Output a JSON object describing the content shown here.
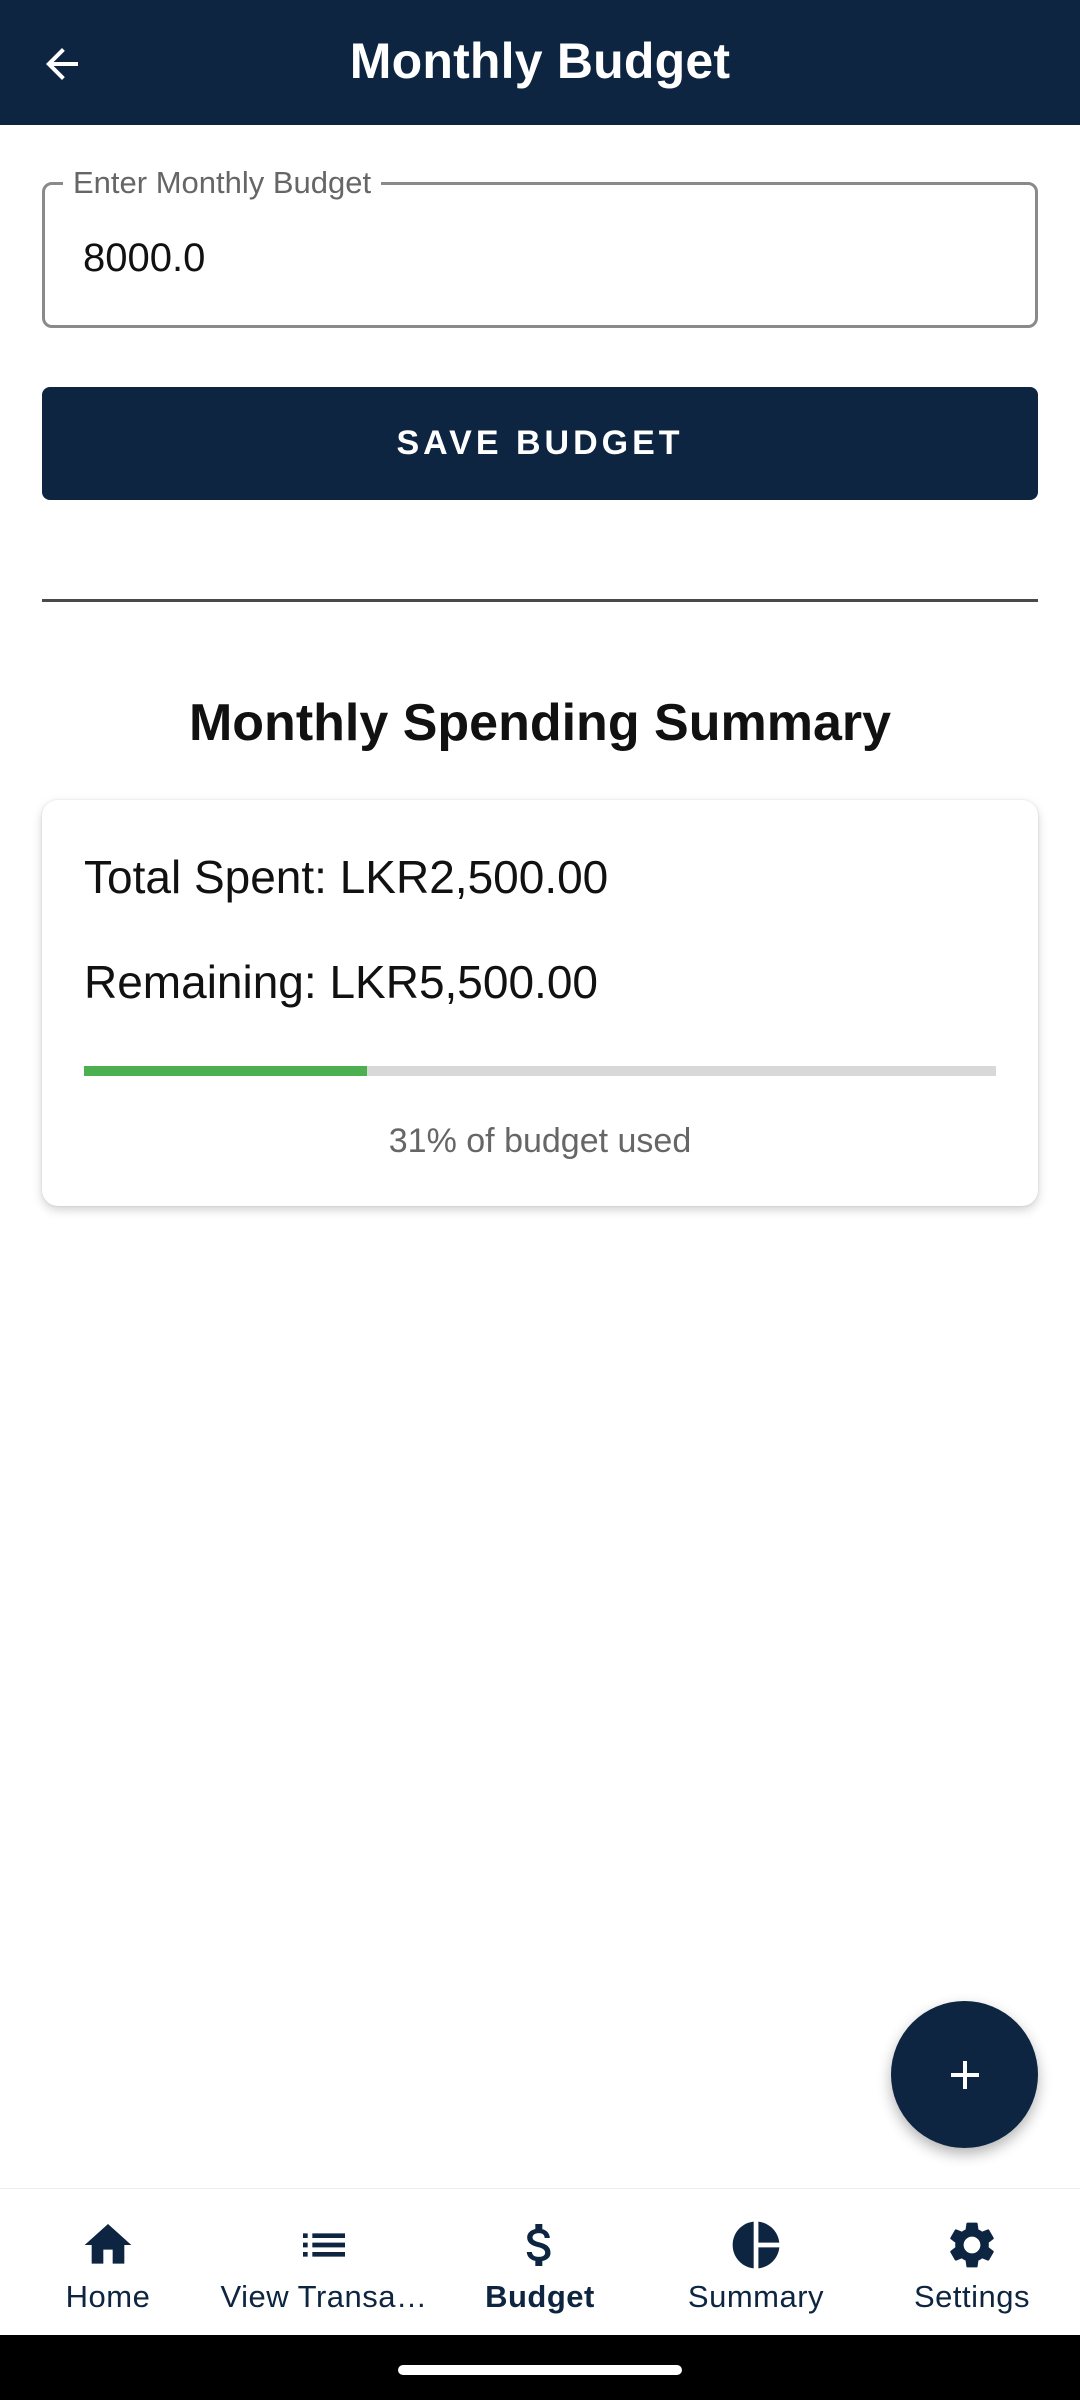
{
  "app_bar": {
    "title": "Monthly Budget",
    "back_icon": "arrow-back-icon"
  },
  "budget_form": {
    "input_label": "Enter Monthly Budget",
    "input_value": "8000.0",
    "save_label": "SAVE BUDGET"
  },
  "summary": {
    "title": "Monthly Spending Summary",
    "total_spent_text": "Total Spent: LKR2,500.00",
    "remaining_text": "Remaining: LKR5,500.00",
    "progress_fraction": 0.31,
    "progress_caption": "31% of budget used",
    "progress_color": "#4caf50"
  },
  "fab": {
    "icon": "add-icon"
  },
  "bottom_nav": {
    "items": [
      {
        "label": "Home",
        "icon": "home-icon",
        "active": false
      },
      {
        "label": "View Transa…",
        "icon": "list-icon",
        "active": false
      },
      {
        "label": "Budget",
        "icon": "dollar-icon",
        "active": true
      },
      {
        "label": "Summary",
        "icon": "pie-chart-icon",
        "active": false
      },
      {
        "label": "Settings",
        "icon": "gear-icon",
        "active": false
      }
    ]
  },
  "colors": {
    "primary": "#0d2540",
    "accent_green": "#4caf50"
  }
}
